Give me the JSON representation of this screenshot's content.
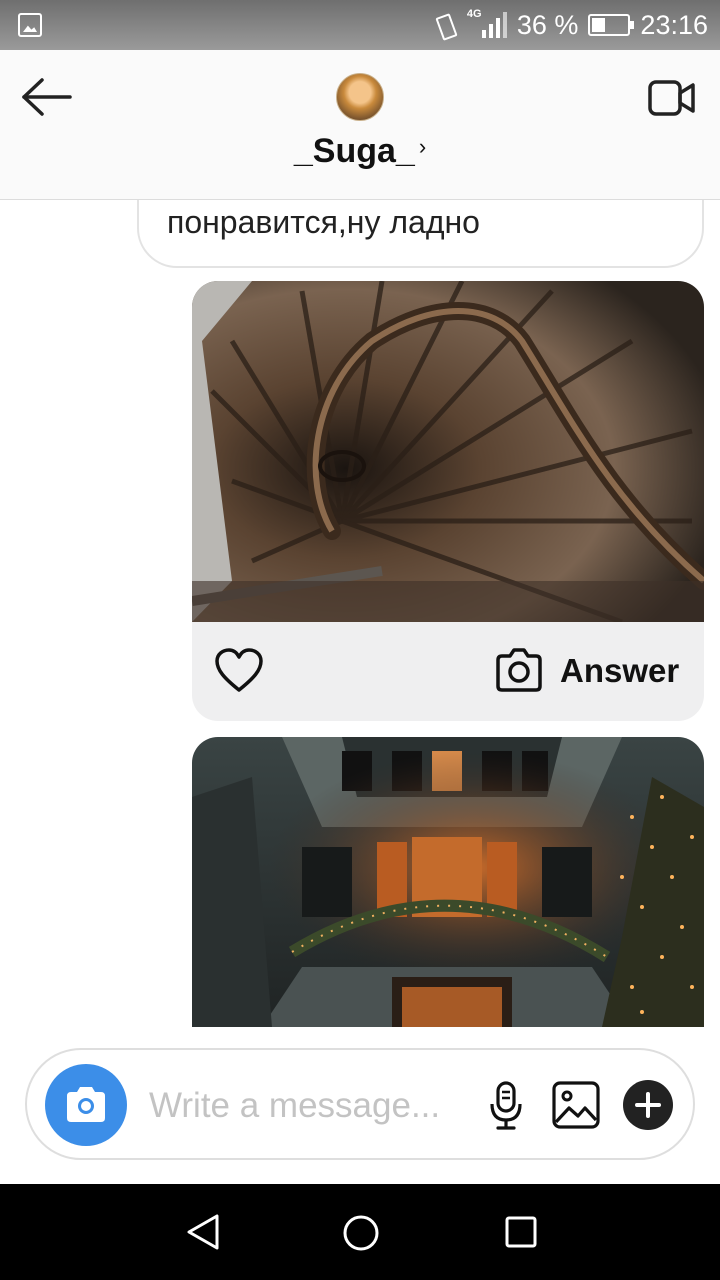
{
  "status_bar": {
    "network": "4G",
    "battery_percent": "36 %",
    "battery_level": 0.36,
    "time": "23:16"
  },
  "header": {
    "username": "_Suga_",
    "chevron": "›"
  },
  "messages": {
    "text_message": "понравится,ну ладно",
    "post_answer_label": "Answer"
  },
  "composer": {
    "placeholder": "Write a message..."
  },
  "icons": {
    "back": "arrow-left-icon",
    "video": "video-camera-icon",
    "heart": "heart-icon",
    "camera": "camera-icon",
    "mic": "microphone-icon",
    "gallery": "image-icon",
    "plus": "plus-icon"
  },
  "colors": {
    "accent": "#3c8ee8",
    "header_bg": "#fafafa",
    "post_card_bg": "#efeff0",
    "navbar": "#000000"
  }
}
